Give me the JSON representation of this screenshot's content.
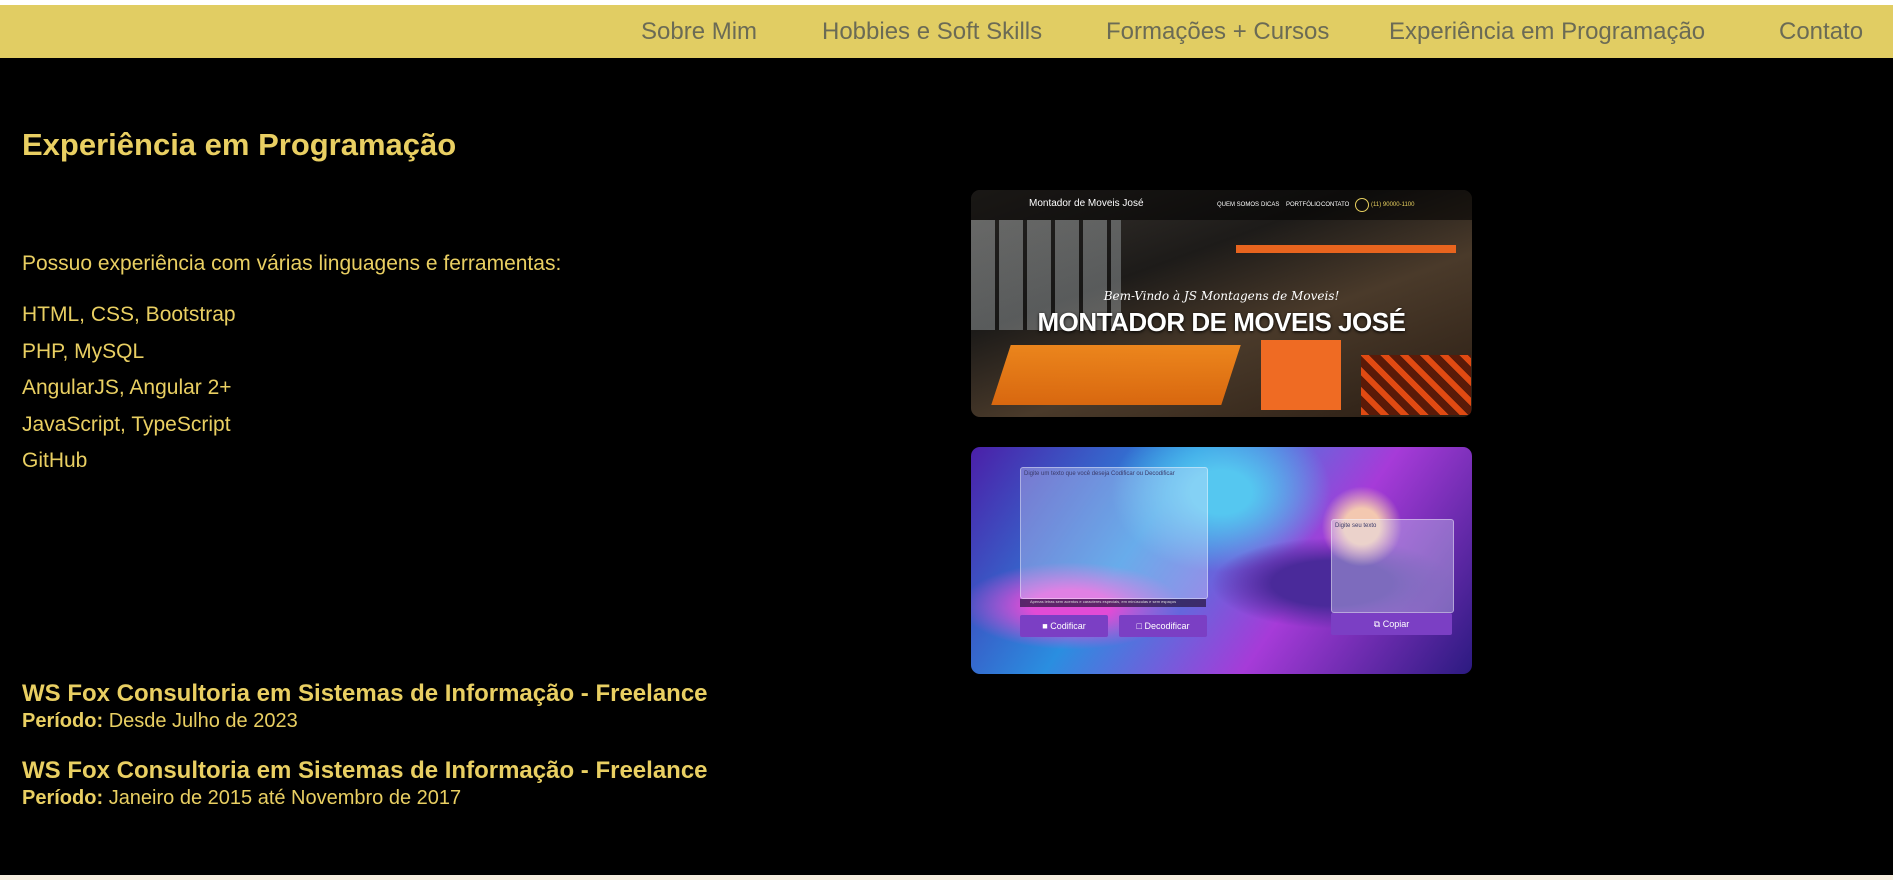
{
  "nav": {
    "items": [
      "Sobre Mim",
      "Hobbies e Soft Skills",
      "Formações + Cursos",
      "Experiência em Programação",
      "Contato"
    ]
  },
  "section": {
    "title": "Experiência em Programação",
    "intro": "Possuo experiência com várias linguagens e ferramentas:",
    "skills": [
      "HTML, CSS, Bootstrap",
      "PHP, MySQL",
      "AngularJS, Angular 2+",
      "JavaScript, TypeScript",
      "GitHub"
    ]
  },
  "jobs": [
    {
      "title": "WS Fox Consultoria em Sistemas de Informação - Freelance",
      "period_label": "Período:",
      "period": "Desde Julho de 2023"
    },
    {
      "title": "WS Fox Consultoria em Sistemas de Informação - Freelance",
      "period_label": "Período:",
      "period": "Janeiro de 2015 até Novembro de 2017"
    }
  ],
  "projects": [
    {
      "brand": "Montador de Moveis José",
      "nav": [
        "QUEM SOMOS",
        "DICAS",
        "PORTFÓLIO",
        "CONTATO"
      ],
      "phone": "(11) 90000-1100",
      "welcome": "Bem-Vindo à JS Montagens de Moveis!",
      "hero": "MONTADOR DE MOVEIS JOSÉ"
    },
    {
      "input_placeholder": "Digite um texto que você deseja Codificar ou Decodificar",
      "output_placeholder": "Digite seu texto",
      "note": "Apenas letras sem acentos e caracteres especiais, em minúsculas e sem espaços",
      "encode_label": "Codificar",
      "decode_label": "Decodificar",
      "copy_label": "Copiar"
    }
  ],
  "colors": {
    "nav_bg": "#e1cd63",
    "nav_text": "#6b6b55",
    "page_bg": "#000000",
    "accent": "#e9cf62",
    "button_purple": "#7b3fc4"
  }
}
